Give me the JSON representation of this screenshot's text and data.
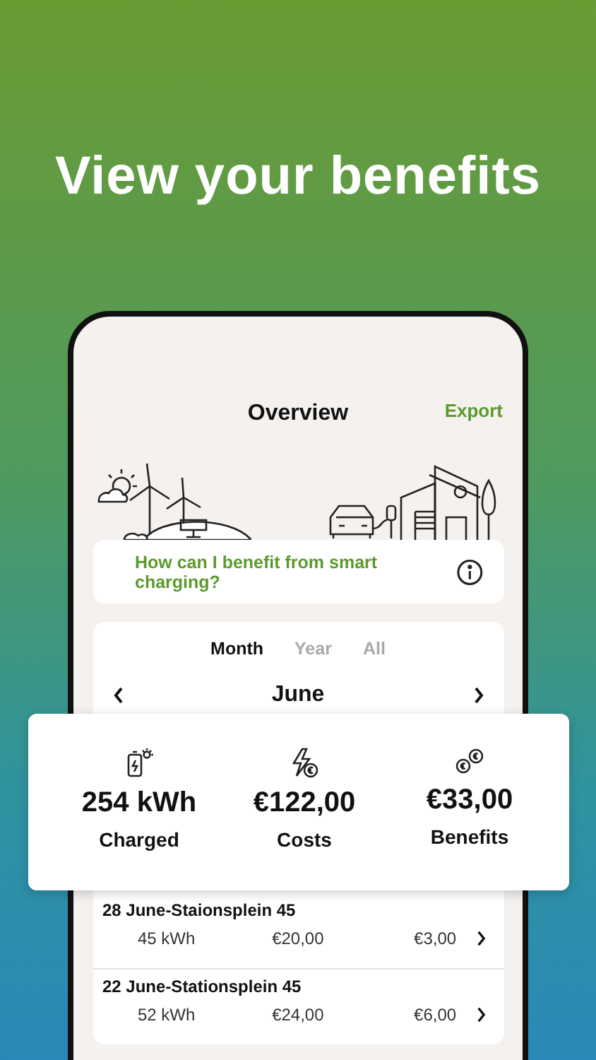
{
  "headline": "View your benefits",
  "header": {
    "title": "Overview",
    "action": "Export"
  },
  "info": {
    "text": "How can I benefit from smart charging?"
  },
  "periods": [
    {
      "label": "Month",
      "selected": true
    },
    {
      "label": "Year",
      "selected": false
    },
    {
      "label": "All",
      "selected": false
    }
  ],
  "month": "June",
  "stats": [
    {
      "kind": "energy",
      "value": "254 kWh",
      "label": "Charged"
    },
    {
      "kind": "cost",
      "value": "€122,00",
      "label": "Costs"
    },
    {
      "kind": "benefit",
      "value": "€33,00",
      "label": "Benefits"
    }
  ],
  "sessions": [
    {
      "title": "28 June-Staionsplein 45",
      "energy": "45 kWh",
      "cost": "€20,00",
      "benefit": "€3,00"
    },
    {
      "title": "22 June-Stationsplein 45",
      "energy": "52 kWh",
      "cost": "€24,00",
      "benefit": "€6,00"
    }
  ]
}
